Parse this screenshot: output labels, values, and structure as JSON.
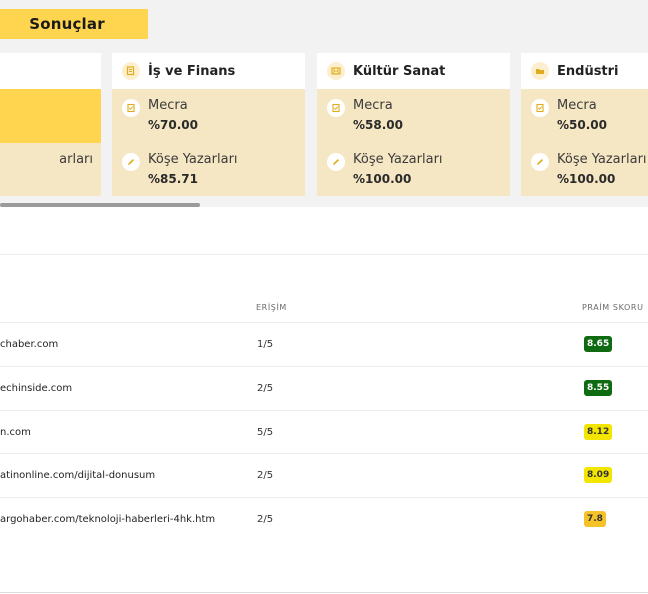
{
  "header": {
    "results_label": "Sonuçlar"
  },
  "cards": [
    {
      "title": "İş ve Finans",
      "icon": "document-icon",
      "metrics": [
        {
          "label": "Mecra",
          "value": "%70.00"
        },
        {
          "label": "Köşe Yazarları",
          "value": "%85.71"
        }
      ]
    },
    {
      "title": "Kültür Sanat",
      "icon": "film-icon",
      "metrics": [
        {
          "label": "Mecra",
          "value": "%58.00"
        },
        {
          "label": "Köşe Yazarları",
          "value": "%100.00"
        }
      ]
    },
    {
      "title": "Endüstri",
      "icon": "folder-icon",
      "metrics": [
        {
          "label": "Mecra",
          "value": "%50.00"
        },
        {
          "label": "Köşe Yazarları",
          "value": "%100.00"
        }
      ]
    }
  ],
  "partial_card": {
    "fragment": "arları"
  },
  "table": {
    "headers": {
      "access": "ERİŞİM",
      "score": "PRAİM SKORU"
    },
    "rows": [
      {
        "url": "chaber.com",
        "access": "1/5",
        "score": "8.65",
        "level": "green"
      },
      {
        "url": "echinside.com",
        "access": "2/5",
        "score": "8.55",
        "level": "green"
      },
      {
        "url": "n.com",
        "access": "5/5",
        "score": "8.12",
        "level": "yellow"
      },
      {
        "url": "atinonline.com/dijital-donusum",
        "access": "2/5",
        "score": "8.09",
        "level": "yellow"
      },
      {
        "url": "argohaber.com/teknoloji-haberleri-4hk.htm",
        "access": "2/5",
        "score": "7.8",
        "level": "amber"
      }
    ]
  },
  "colors": {
    "accent": "#ffd54f",
    "card_bg": "#f6e7c4",
    "score_green": "#0e6b12",
    "score_yellow": "#f2e600",
    "score_amber": "#f5c227"
  }
}
